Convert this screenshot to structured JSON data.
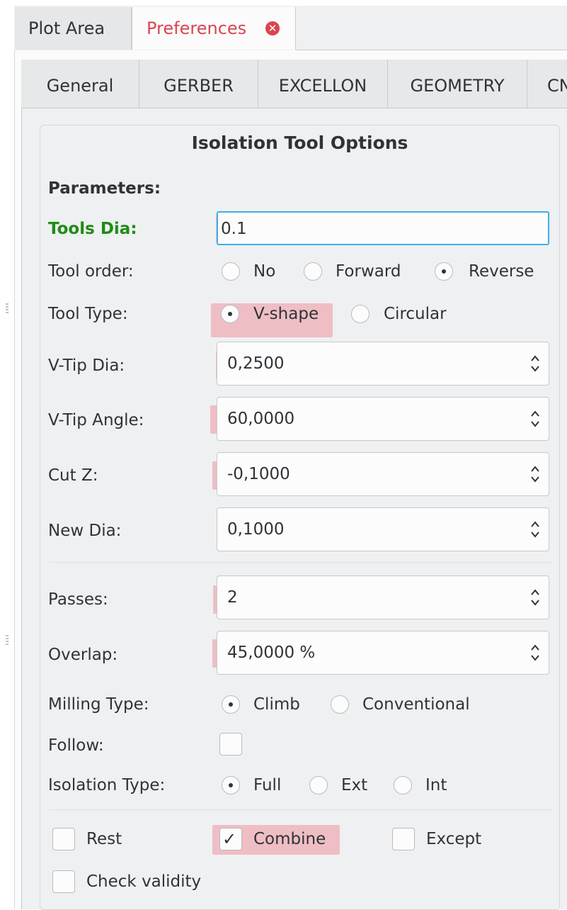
{
  "outer_tabs": {
    "plot_area": "Plot Area",
    "preferences": "Preferences",
    "close_glyph": "✕"
  },
  "inner_tabs": [
    "General",
    "GERBER",
    "EXCELLON",
    "GEOMETRY",
    "CNC"
  ],
  "panel": {
    "title": "Isolation Tool Options",
    "parameters_label": "Parameters:",
    "tools_dia": {
      "label": "Tools Dia:",
      "value": "0.1"
    },
    "tool_order": {
      "label": "Tool order:",
      "options": [
        "No",
        "Forward",
        "Reverse"
      ],
      "selected": "Reverse"
    },
    "tool_type": {
      "label": "Tool Type:",
      "options": [
        "V-shape",
        "Circular"
      ],
      "selected": "V-shape"
    },
    "vtip_dia": {
      "label": "V-Tip Dia:",
      "value": "0,2500"
    },
    "vtip_angle": {
      "label": "V-Tip Angle:",
      "value": "60,0000"
    },
    "cut_z": {
      "label": "Cut Z:",
      "value": "-0,1000"
    },
    "new_dia": {
      "label": "New Dia:",
      "value": "0,1000"
    },
    "passes": {
      "label": "Passes:",
      "value": "2"
    },
    "overlap": {
      "label": "Overlap:",
      "value": "45,0000 %"
    },
    "milling_type": {
      "label": "Milling Type:",
      "options": [
        "Climb",
        "Conventional"
      ],
      "selected": "Climb"
    },
    "follow": {
      "label": "Follow:",
      "checked": false
    },
    "isolation_type": {
      "label": "Isolation Type:",
      "options": [
        "Full",
        "Ext",
        "Int"
      ],
      "selected": "Full"
    },
    "rest": {
      "label": "Rest",
      "checked": false
    },
    "combine": {
      "label": "Combine",
      "checked": true
    },
    "except": {
      "label": "Except",
      "checked": false
    },
    "check_validity": {
      "label": "Check validity",
      "checked": false
    }
  },
  "colors": {
    "accent_red": "#da4453",
    "focus_blue": "#3daee9",
    "green_label": "#1f8c16",
    "highlight": "rgba(238,60,80,0.28)"
  },
  "icons": {
    "close": "close-icon",
    "spin": "spinbox-arrows-icon",
    "check": "checkmark-icon"
  }
}
